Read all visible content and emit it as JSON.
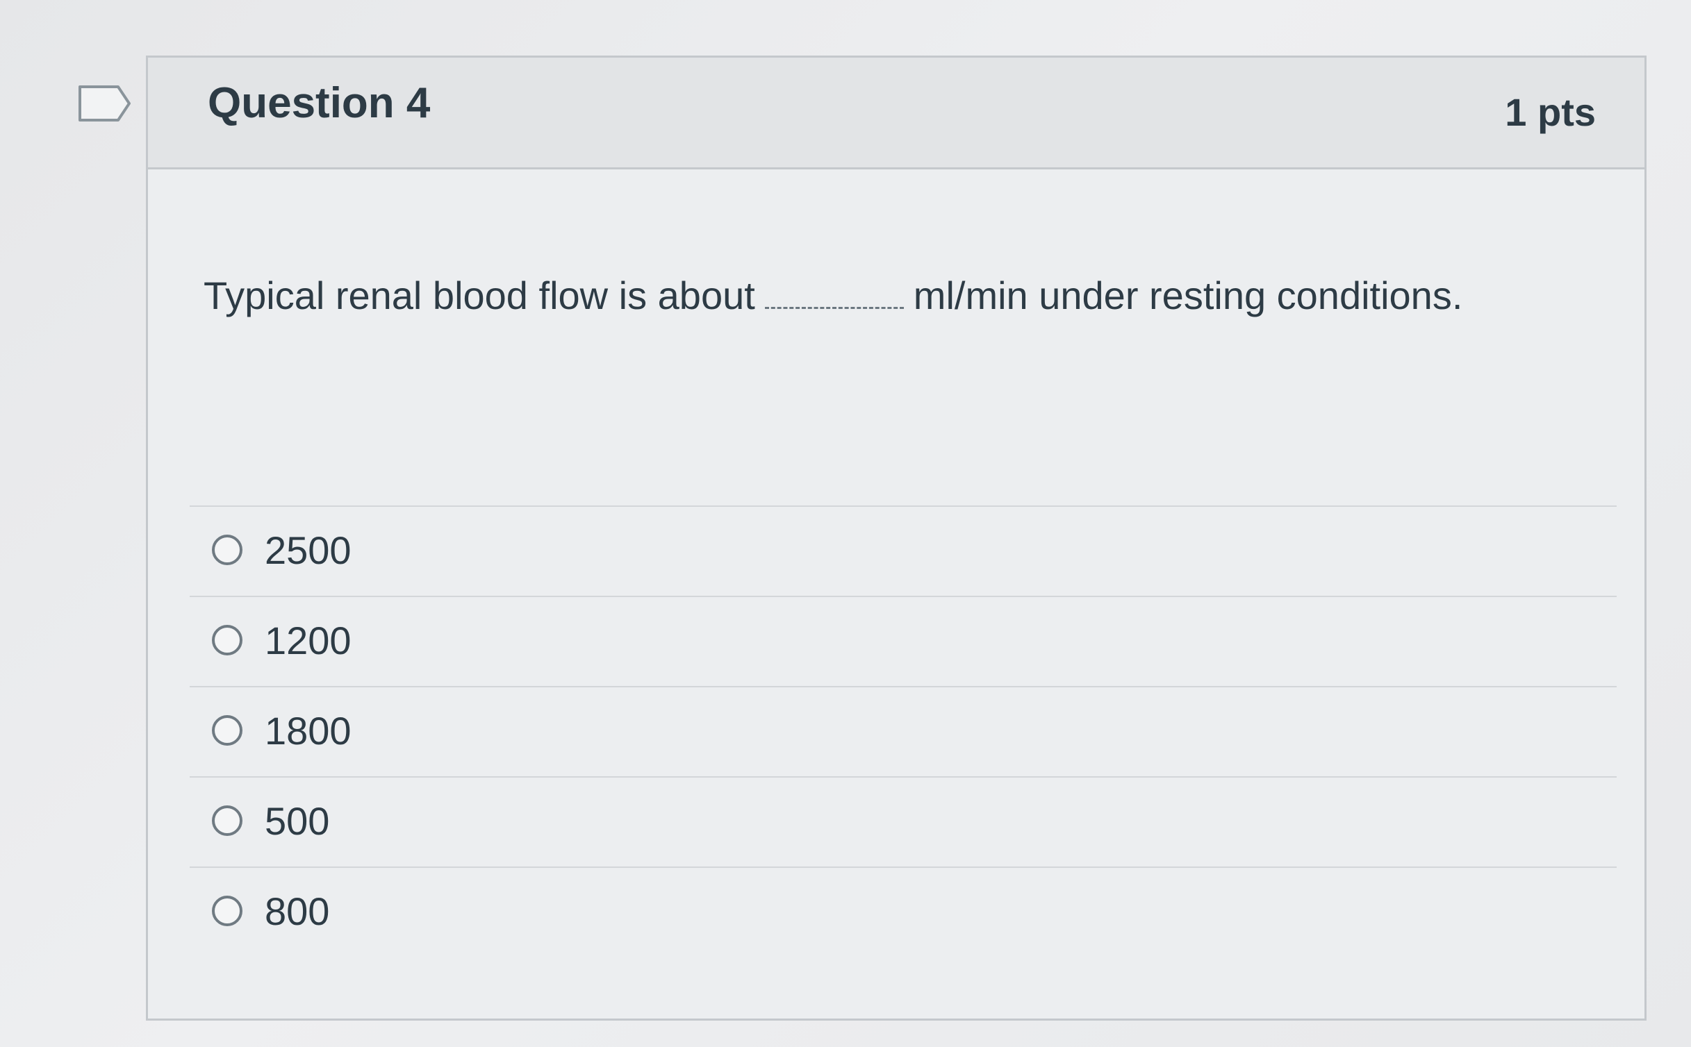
{
  "question": {
    "title": "Question 4",
    "points": "1 pts",
    "text_before": "Typical renal blood flow is about",
    "text_after": "ml/min under resting conditions.",
    "flag_icon": "bookmark-flag-icon"
  },
  "answers": [
    {
      "label": "2500"
    },
    {
      "label": "1200"
    },
    {
      "label": "1800"
    },
    {
      "label": "500"
    },
    {
      "label": "800"
    }
  ]
}
